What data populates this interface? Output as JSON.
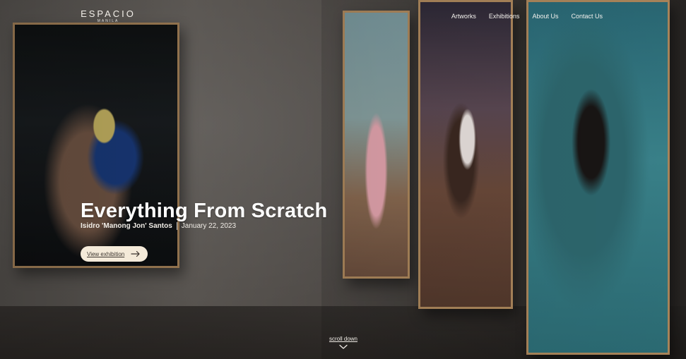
{
  "brand": {
    "logo_main": "ESPACIO",
    "logo_sub": "MANILA"
  },
  "nav": {
    "items": [
      {
        "label": "Artworks"
      },
      {
        "label": "Exhibitions"
      },
      {
        "label": "About Us"
      },
      {
        "label": "Contact Us"
      }
    ]
  },
  "hero": {
    "title": "Everything From Scratch",
    "artist": "Isidro 'Manong Jon' Santos",
    "date": "January 22, 2023",
    "button_label": "View exhibition",
    "button_icon": "arrow-right-icon",
    "scroll_label": "scroll down",
    "scroll_icon": "chevron-down-icon"
  }
}
